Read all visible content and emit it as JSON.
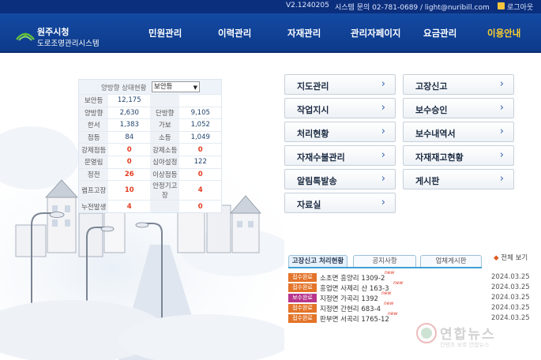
{
  "topbar": {
    "version": "V2.1240205",
    "system_contact": "시스템 문의 02-781-0689 / light@nuribill.com",
    "logout": "로그아웃"
  },
  "header": {
    "logo_title": "원주시청",
    "logo_subtitle": "도로조명관리시스템",
    "nav": [
      "민원관리",
      "이력관리",
      "자재관리",
      "관리자페이지",
      "요금관리",
      "이용안내"
    ]
  },
  "status": {
    "title": "양방향 상태현황",
    "selected": "보안등",
    "rows": [
      {
        "l1": "보안등",
        "v1": "12,175",
        "l2": "",
        "v2": ""
      },
      {
        "l1": "양방향",
        "v1": "2,630",
        "l2": "단방향",
        "v2": "9,105"
      },
      {
        "l1": "한서",
        "v1": "1,383",
        "l2": "가보",
        "v2": "1,052"
      },
      {
        "l1": "점등",
        "v1": "84",
        "l2": "소등",
        "v2": "1,049"
      },
      {
        "l1": "강제점등",
        "v1": "0",
        "l2": "강제소등",
        "v2": "0"
      },
      {
        "l1": "문열림",
        "v1": "0",
        "l2": "심야설정",
        "v2": "122"
      },
      {
        "l1": "정전",
        "v1": "26",
        "l2": "이상점등",
        "v2": "0"
      },
      {
        "l1": "램프고장",
        "v1": "10",
        "l2": "안정기고장",
        "v2": "4"
      },
      {
        "l1": "누전발생",
        "v1": "4",
        "l2": "",
        "v2": "0"
      }
    ]
  },
  "menu": {
    "left": [
      "지도관리",
      "작업지시",
      "처리현황",
      "자재수불관리",
      "알림톡발송",
      "자료실"
    ],
    "right": [
      "고장신고",
      "보수승인",
      "보수내역서",
      "자재재고현황",
      "게시판"
    ]
  },
  "board": {
    "tabs": [
      "고장신고 처리현황",
      "공지사항",
      "업체게시판"
    ],
    "view_all": "전체 보기",
    "rows": [
      {
        "badge": "접수완료",
        "color": "#e3742a",
        "title": "소초면 흥양리 1309-2",
        "new": "new",
        "date": "2024.03.25"
      },
      {
        "badge": "접수완료",
        "color": "#e3742a",
        "title": "흥업면 사제리 산 163-3",
        "new": "new",
        "date": "2024.03.25"
      },
      {
        "badge": "보수완료",
        "color": "#b8368d",
        "title": "지정면 가곡리 1392",
        "new": "new",
        "date": "2024.03.25"
      },
      {
        "badge": "접수완료",
        "color": "#e3742a",
        "title": "지정면 간현리 683-4",
        "new": "new",
        "date": "2024.03.25"
      },
      {
        "badge": "접수완료",
        "color": "#e3742a",
        "title": "판부면 서곡리 1765-12",
        "new": "new",
        "date": "2024.03.25"
      }
    ]
  },
  "watermark": {
    "text": "연합뉴스",
    "sub": "컨텐츠 보호 연합뉴스"
  }
}
